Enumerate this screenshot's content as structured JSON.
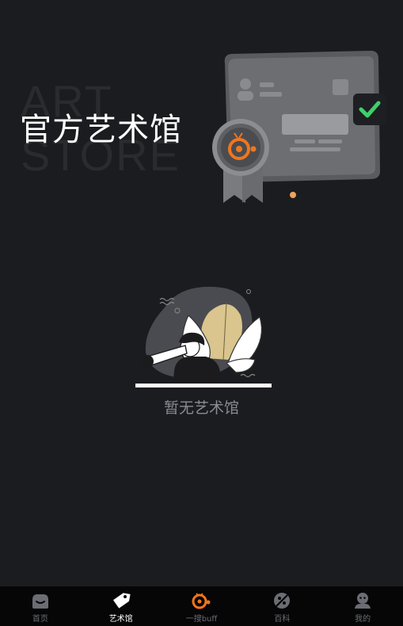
{
  "banner": {
    "bg_word_1": "ART",
    "bg_word_2": "STORE",
    "title": "官方艺术馆"
  },
  "empty_state": {
    "text": "暂无艺术馆"
  },
  "tabbar": {
    "tabs": [
      {
        "label": "首页",
        "icon": "home-icon",
        "active": false
      },
      {
        "label": "艺术馆",
        "icon": "tag-icon",
        "active": true
      },
      {
        "label": "一搜buff",
        "icon": "search-buff-icon",
        "active": false
      },
      {
        "label": "百科",
        "icon": "encyclopedia-icon",
        "active": false
      },
      {
        "label": "我的",
        "icon": "profile-icon",
        "active": false
      }
    ]
  },
  "colors": {
    "background": "#1b1c20",
    "tabbar_bg": "#060607",
    "accent_orange": "#f0761e",
    "check_green": "#3ecf6b",
    "inactive_label": "#6b6d73",
    "empty_text": "#8a8c92"
  }
}
